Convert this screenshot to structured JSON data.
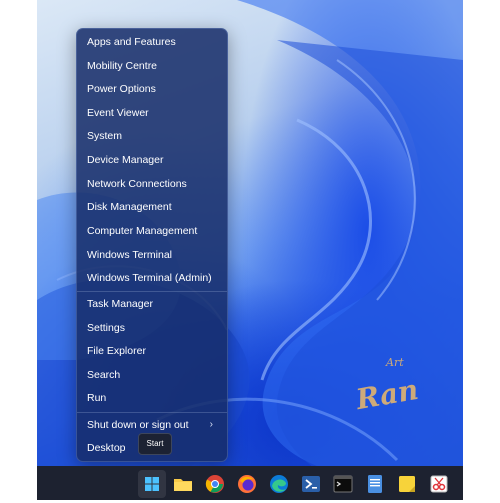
{
  "menu": {
    "items": [
      {
        "label": "Apps and Features"
      },
      {
        "label": "Mobility Centre"
      },
      {
        "label": "Power Options"
      },
      {
        "label": "Event Viewer"
      },
      {
        "label": "System"
      },
      {
        "label": "Device Manager"
      },
      {
        "label": "Network Connections"
      },
      {
        "label": "Disk Management"
      },
      {
        "label": "Computer Management"
      },
      {
        "label": "Windows Terminal"
      },
      {
        "label": "Windows Terminal (Admin)"
      },
      {
        "label": "Task Manager"
      },
      {
        "label": "Settings"
      },
      {
        "label": "File Explorer"
      },
      {
        "label": "Search"
      },
      {
        "label": "Run"
      },
      {
        "label": "Shut down or sign out"
      },
      {
        "label": "Desktop"
      }
    ]
  },
  "tooltip": {
    "label": "Start"
  },
  "watermark": {
    "top": "Art",
    "main": "Ran"
  },
  "taskbar": {
    "icons": [
      "windows-start-icon",
      "file-explorer-icon",
      "chrome-icon",
      "firefox-icon",
      "edge-icon",
      "powershell-icon",
      "terminal-icon",
      "notepad-icon",
      "sticky-notes-icon",
      "snipping-tool-icon"
    ]
  },
  "colors": {
    "accent": "#2a66e8",
    "menu_bg": "#162c69",
    "taskbar_bg": "#1d2230"
  }
}
